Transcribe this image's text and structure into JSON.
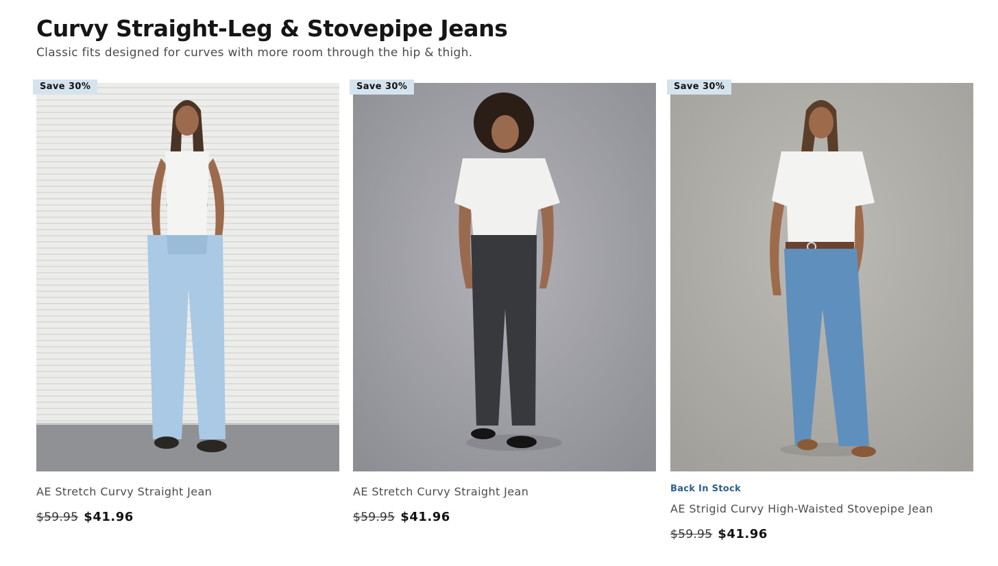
{
  "header": {
    "title": "Curvy Straight-Leg & Stovepipe Jeans",
    "subtitle": "Classic fits designed for curves with more room through the hip & thigh."
  },
  "products": [
    {
      "badge": "Save 30%",
      "stock_tag": "",
      "name": "AE Stretch Curvy Straight Jean",
      "price_old": "$59.95",
      "price_new": "$41.96",
      "image": "model-light-wash-jeans-white-tank-photo"
    },
    {
      "badge": "Save 30%",
      "stock_tag": "",
      "name": "AE Stretch Curvy Straight Jean",
      "price_old": "$59.95",
      "price_new": "$41.96",
      "image": "model-black-jeans-white-tee-photo"
    },
    {
      "badge": "Save 30%",
      "stock_tag": "Back In Stock",
      "name": "AE Strigid Curvy High-Waisted Stovepipe Jean",
      "price_old": "$59.95",
      "price_new": "$41.96",
      "image": "model-medium-wash-stovepipe-jeans-photo"
    }
  ],
  "colors": {
    "badge_bg": "#d5e3ef",
    "stock_tag": "#2d5f8f",
    "title": "#151515"
  }
}
